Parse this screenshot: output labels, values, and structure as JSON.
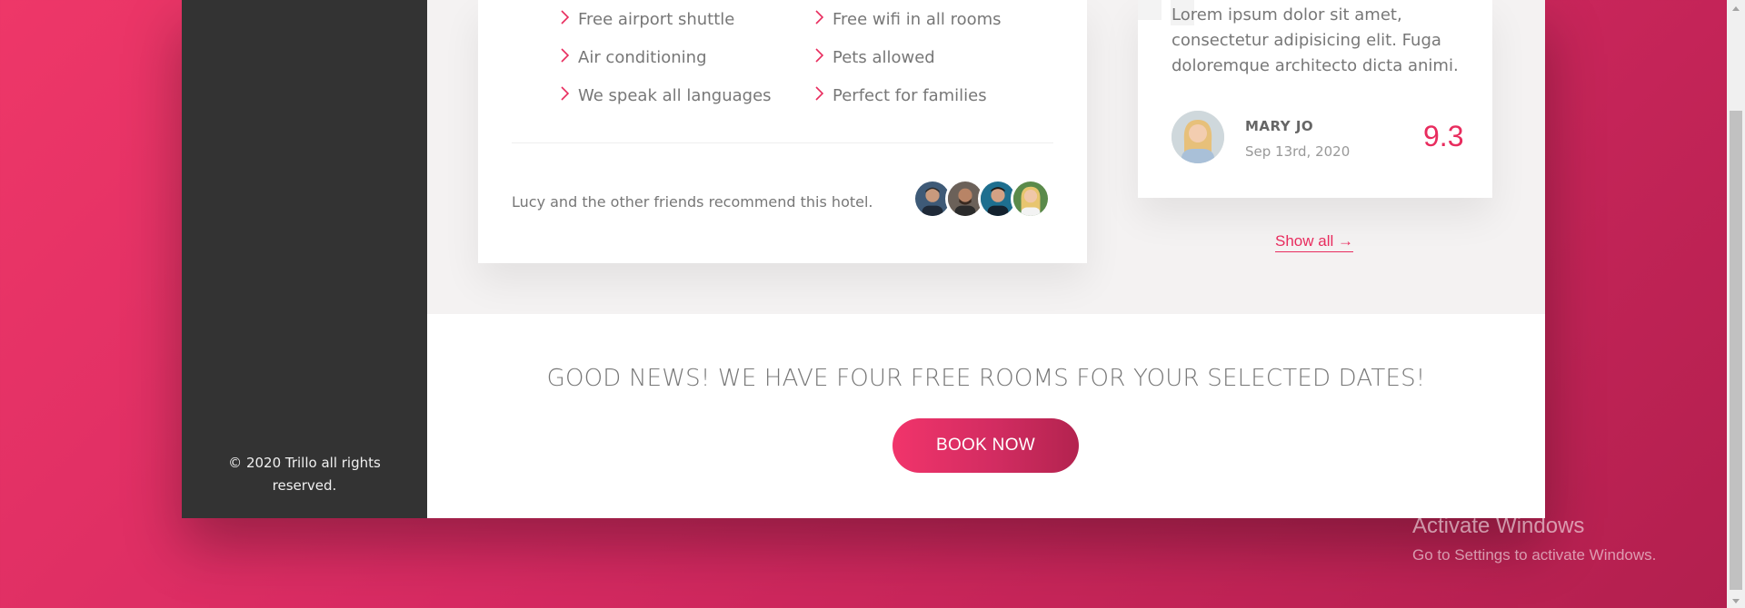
{
  "sidebar": {
    "legal": "© 2020 Trillo all rights reserved."
  },
  "description": {
    "features": [
      "Free airport shuttle",
      "Free wifi in all rooms",
      "Air conditioning",
      "Pets allowed",
      "We speak all languages",
      "Perfect for families"
    ],
    "recommend_text": "Lucy and the other friends recommend this hotel.",
    "friends": [
      "friend-1",
      "friend-2",
      "friend-3",
      "friend-4"
    ]
  },
  "review": {
    "text": "Lorem ipsum dolor sit amet, consectetur adipisicing elit. Fuga doloremque architecto dicta animi.",
    "name": "Mary Jo",
    "date": "Sep 13rd, 2020",
    "rating": "9.3",
    "show_all": "Show all →"
  },
  "cta": {
    "title": "GOOD NEWS! WE HAVE FOUR FREE ROOMS FOR YOUR SELECTED DATES!",
    "button": "BOOK NOW"
  },
  "watermark": {
    "title": "Activate Windows",
    "subtitle": "Go to Settings to activate Windows."
  },
  "colors": {
    "primary": "#e82c5e",
    "sidebar": "#333333",
    "background_gradient": [
      "#ee3768",
      "#b21f4e"
    ]
  }
}
